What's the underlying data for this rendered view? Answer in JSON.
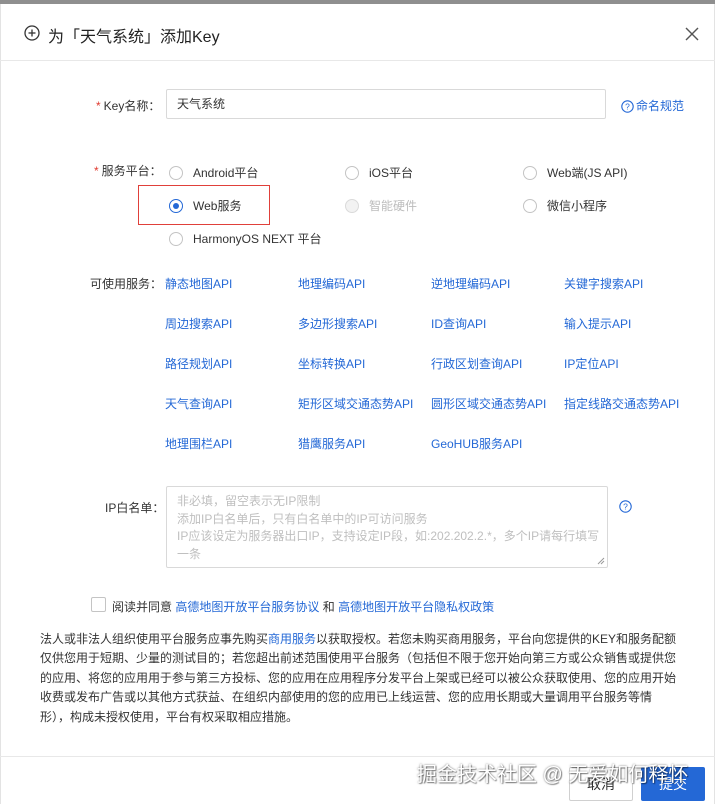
{
  "dialog": {
    "title": "为「天气系统」添加Key",
    "close_icon": "close-icon",
    "add_icon": "plus-circle-icon"
  },
  "form": {
    "key_name": {
      "required_mark": "*",
      "label": "Key名称：",
      "value": "天气系统",
      "help": "命名规范"
    },
    "platform": {
      "required_mark": "*",
      "label": "服务平台：",
      "options": [
        {
          "label": "Android平台",
          "state": "unchecked"
        },
        {
          "label": "iOS平台",
          "state": "unchecked"
        },
        {
          "label": "Web端(JS API)",
          "state": "unchecked"
        },
        {
          "label": "Web服务",
          "state": "checked"
        },
        {
          "label": "智能硬件",
          "state": "disabled"
        },
        {
          "label": "微信小程序",
          "state": "unchecked"
        },
        {
          "label": "HarmonyOS NEXT 平台",
          "state": "unchecked"
        }
      ],
      "highlight_color": "#e0403a"
    },
    "services": {
      "label": "可使用服务：",
      "items": [
        "静态地图API",
        "地理编码API",
        "逆地理编码API",
        "关键字搜索API",
        "周边搜索API",
        "多边形搜索API",
        "ID查询API",
        "输入提示API",
        "路径规划API",
        "坐标转换API",
        "行政区划查询API",
        "IP定位API",
        "天气查询API",
        "矩形区域交通态势API",
        "圆形区域交通态势API",
        "指定线路交通态势API",
        "地理围栏API",
        "猎鹰服务API",
        "GeoHUB服务API"
      ]
    },
    "ip_whitelist": {
      "label": "IP白名单：",
      "placeholder_lines": [
        "非必填，留空表示无IP限制",
        "添加IP白名单后，只有白名单中的IP可访问服务",
        "IP应该设定为服务器出口IP，支持设定IP段，如:202.202.2.*，多个IP请每行填写",
        "一条"
      ]
    }
  },
  "agreement": {
    "prefix": "阅读并同意",
    "link1": "高德地图开放平台服务协议",
    "and": "和",
    "link2": "高德地图开放平台隐私权政策"
  },
  "notice": {
    "part1": "法人或非法人组织使用平台服务应事先购买",
    "link": "商用服务",
    "part2": "以获取授权。若您未购买商用服务，平台向您提供的KEY和服务配额仅供您用于短期、少量的测试目的；若您超出前述范围使用平台服务（包括但不限于您开始向第三方或公众销售或提供您的应用、将您的应用用于参与第三方投标、您的应用在应用程序分发平台上架或已经可以被公众获取使用、您的应用开始收费或发布广告或以其他方式获益、在组织内部使用的您的应用已上线运营、您的应用长期或大量调用平台服务等情形），构成未授权使用，平台有权采取相应措施。"
  },
  "footer": {
    "cancel": "取消",
    "submit": "提交"
  },
  "watermark": "掘金技术社区 @ 无爱如何释怀",
  "colors": {
    "link": "#2468d6",
    "required": "#e03a2f",
    "primary_button": "#2468d6"
  }
}
